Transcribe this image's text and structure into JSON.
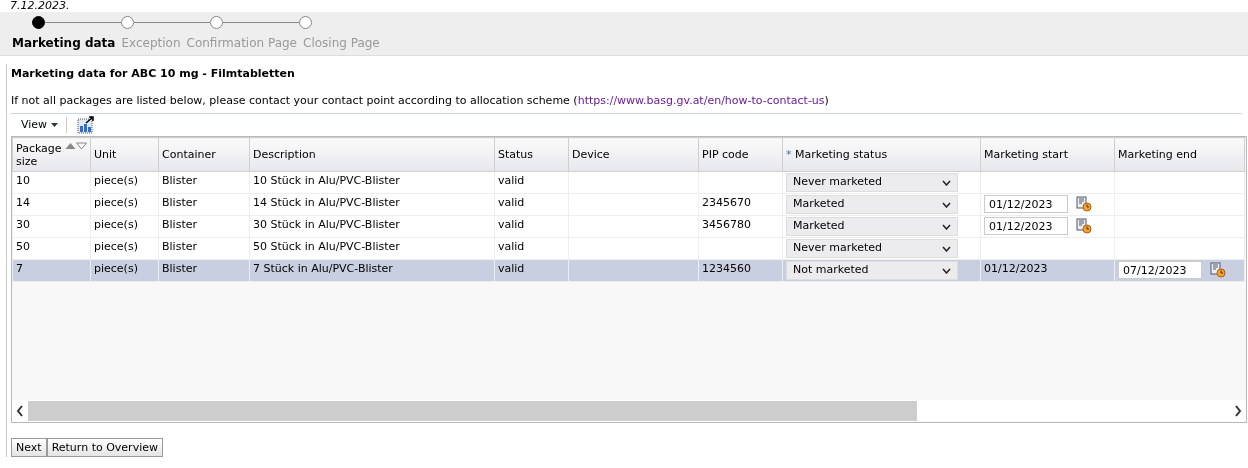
{
  "cut_heading": "7.12.2023.",
  "train": [
    {
      "label": "Marketing data",
      "selected": true
    },
    {
      "label": "Exception",
      "selected": false
    },
    {
      "label": "Confirmation Page",
      "selected": false
    },
    {
      "label": "Closing Page",
      "selected": false
    }
  ],
  "panel_title": "Marketing data for ABC 10 mg - Filmtabletten",
  "info_text": "If not all packages are listed below, please contact your contact point according to allocation scheme (",
  "info_link": "https://www.basg.gv.at/en/how-to-contact-us",
  "info_end": ")",
  "toolbar": {
    "view_menu": "View"
  },
  "table": {
    "columns": [
      {
        "label": "Package size",
        "sortable": true
      },
      {
        "label": "Unit",
        "sortable": false
      },
      {
        "label": "Container",
        "sortable": false
      },
      {
        "label": "Description",
        "sortable": false
      },
      {
        "label": "Status",
        "sortable": false
      },
      {
        "label": "Device",
        "sortable": false
      },
      {
        "label": "PIP code",
        "sortable": false
      },
      {
        "label": "Marketing status",
        "sortable": false,
        "required_mark": "*"
      },
      {
        "label": "Marketing start",
        "sortable": false
      },
      {
        "label": "Marketing end",
        "sortable": false
      }
    ],
    "rows": [
      {
        "selected": false,
        "package_size": "10",
        "unit": "piece(s)",
        "container": "Blister",
        "description": "10 Stück in Alu/PVC-Blister",
        "status": "valid",
        "pip_code": "",
        "marketing_status": "Never marketed",
        "marketing_start": null,
        "marketing_end": null
      },
      {
        "selected": false,
        "package_size": "14",
        "unit": "piece(s)",
        "container": "Blister",
        "description": "14 Stück in Alu/PVC-Blister",
        "status": "valid",
        "pip_code": "2345670",
        "marketing_status": "Marketed",
        "marketing_start": {
          "kind": "input",
          "value": "01/12/2023"
        },
        "marketing_end": null
      },
      {
        "selected": false,
        "package_size": "30",
        "unit": "piece(s)",
        "container": "Blister",
        "description": "30 Stück in Alu/PVC-Blister",
        "status": "valid",
        "pip_code": "3456780",
        "marketing_status": "Marketed",
        "marketing_start": {
          "kind": "input",
          "value": "01/12/2023"
        },
        "marketing_end": null
      },
      {
        "selected": false,
        "package_size": "50",
        "unit": "piece(s)",
        "container": "Blister",
        "description": "50 Stück in Alu/PVC-Blister",
        "status": "valid",
        "pip_code": "",
        "marketing_status": "Never marketed",
        "marketing_start": null,
        "marketing_end": null
      },
      {
        "selected": true,
        "package_size": "7",
        "unit": "piece(s)",
        "container": "Blister",
        "description": "7 Stück in Alu/PVC-Blister",
        "status": "valid",
        "pip_code": "1234560",
        "marketing_status": "Not marketed",
        "marketing_start": {
          "kind": "text",
          "value": "01/12/2023"
        },
        "marketing_end": {
          "kind": "input",
          "value": "07/12/2023"
        }
      }
    ]
  },
  "buttons": [
    "Next",
    "Return to Overview"
  ]
}
